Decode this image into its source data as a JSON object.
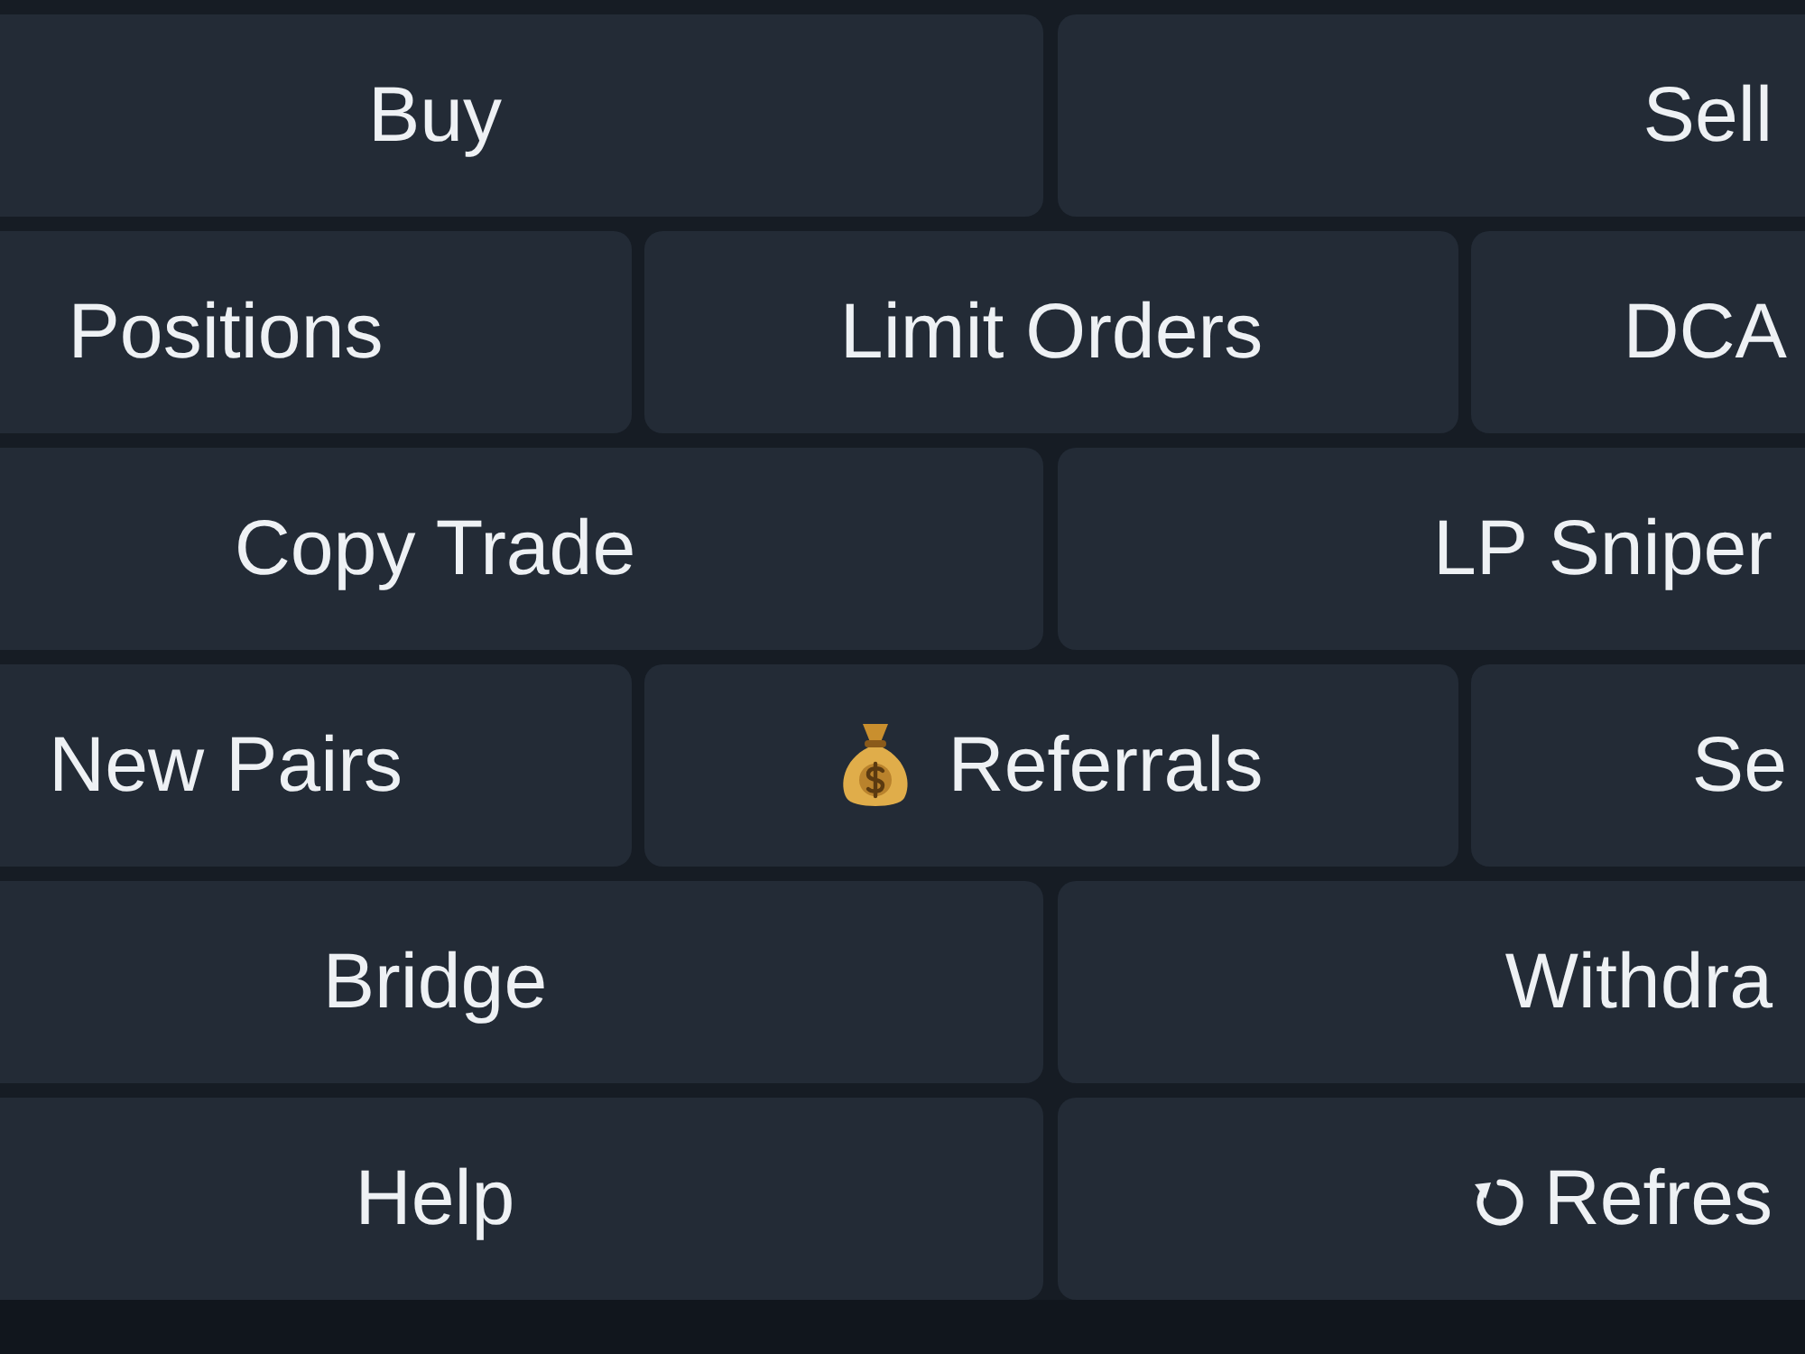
{
  "keyboard": {
    "rows": [
      {
        "buttons": [
          {
            "label": "Buy",
            "kind": "plain"
          },
          {
            "label": "Sell",
            "kind": "plain"
          }
        ]
      },
      {
        "buttons": [
          {
            "label": "Positions",
            "kind": "plain"
          },
          {
            "label": "Limit Orders",
            "kind": "plain"
          },
          {
            "label": "DCA",
            "kind": "plain"
          }
        ]
      },
      {
        "buttons": [
          {
            "label": "Copy Trade",
            "kind": "plain"
          },
          {
            "label": "LP Sniper",
            "kind": "plain"
          }
        ]
      },
      {
        "buttons": [
          {
            "label": "New Pairs",
            "kind": "plain"
          },
          {
            "label": "Referrals",
            "kind": "bag"
          },
          {
            "label": "Se",
            "kind": "plain"
          }
        ]
      },
      {
        "buttons": [
          {
            "label": "Bridge",
            "kind": "plain"
          },
          {
            "label": "Withdra",
            "kind": "plain"
          }
        ]
      },
      {
        "buttons": [
          {
            "label": "Help",
            "kind": "plain"
          },
          {
            "label": "Refres",
            "kind": "refresh"
          }
        ]
      }
    ]
  }
}
